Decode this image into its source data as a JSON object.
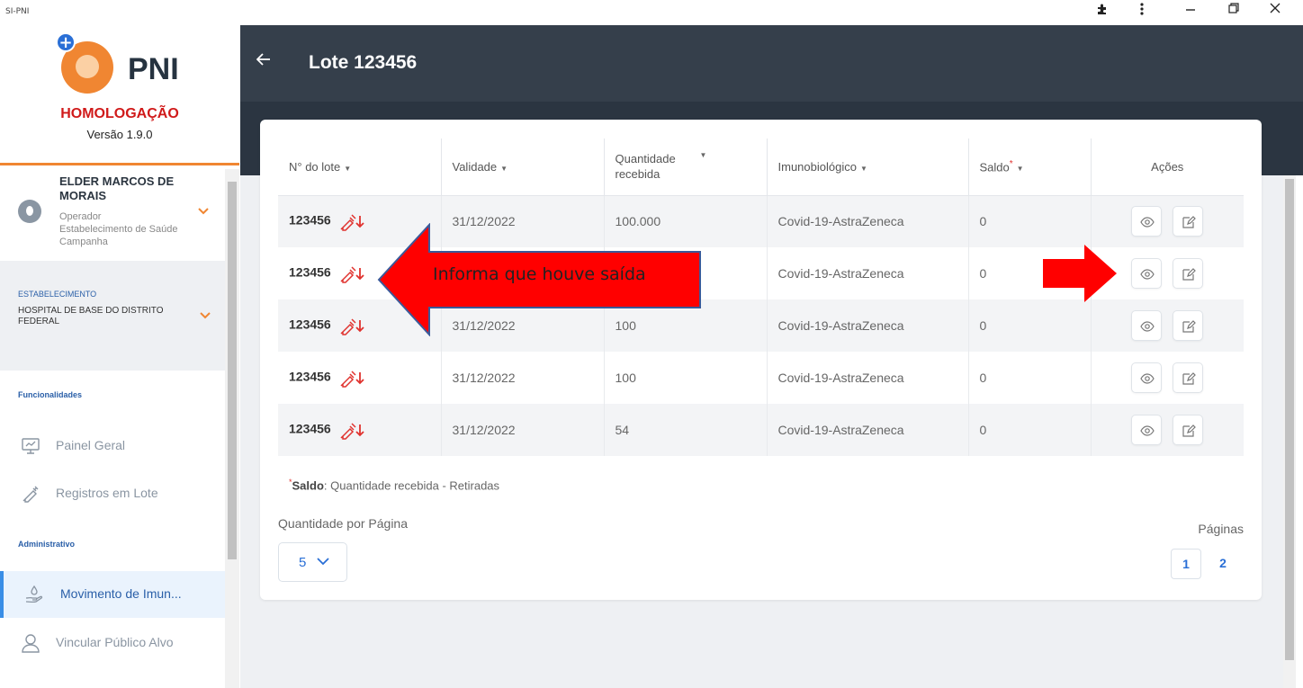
{
  "window": {
    "app_title": "SI-PNI",
    "controls": [
      "puzzle-icon",
      "menu-icon",
      "minimize-icon",
      "restore-icon",
      "close-icon"
    ]
  },
  "sidebar": {
    "logo_text": "PNI",
    "environment": "HOMOLOGAÇÃO",
    "version": "Versão 1.9.0",
    "user": {
      "name": "ELDER MARCOS DE MORAIS",
      "role": "Operador",
      "unit": "Estabelecimento de Saúde Campanha"
    },
    "establishment": {
      "title": "ESTABELECIMENTO",
      "name": "HOSPITAL DE BASE DO DISTRITO FEDERAL"
    },
    "sections": [
      {
        "label": "Funcionalidades",
        "items": [
          {
            "label": "Painel Geral",
            "icon": "monitor-icon"
          },
          {
            "label": "Registros em Lote",
            "icon": "syringe-icon"
          }
        ]
      },
      {
        "label": "Administrativo",
        "items": [
          {
            "label": "Movimento de Imun...",
            "icon": "hand-drop-icon",
            "active": true
          },
          {
            "label": "Vincular Público Alvo",
            "icon": "user-icon"
          }
        ]
      }
    ]
  },
  "header": {
    "title": "Lote 123456"
  },
  "table": {
    "columns": [
      "N° do lote",
      "Validade",
      "Quantidade recebida",
      "Imunobiológico",
      "Saldo",
      "Ações"
    ],
    "rows": [
      {
        "lote": "123456",
        "validade": "31/12/2022",
        "quantidade": "100.000",
        "imuno": "Covid-19-AstraZeneca",
        "saldo": "0"
      },
      {
        "lote": "123456",
        "validade": "",
        "quantidade": "",
        "imuno": "Covid-19-AstraZeneca",
        "saldo": "0"
      },
      {
        "lote": "123456",
        "validade": "31/12/2022",
        "quantidade": "100",
        "imuno": "Covid-19-AstraZeneca",
        "saldo": "0"
      },
      {
        "lote": "123456",
        "validade": "31/12/2022",
        "quantidade": "100",
        "imuno": "Covid-19-AstraZeneca",
        "saldo": "0"
      },
      {
        "lote": "123456",
        "validade": "31/12/2022",
        "quantidade": "54",
        "imuno": "Covid-19-AstraZeneca",
        "saldo": "0"
      }
    ]
  },
  "footnote": {
    "term": "Saldo",
    "text": ": Quantidade recebida - Retiradas"
  },
  "pagination": {
    "per_page_label": "Quantidade por Página",
    "per_page_value": "5",
    "pages_label": "Páginas",
    "pages": [
      "1",
      "2"
    ],
    "current_page": "1"
  },
  "annotation": {
    "callout_text": "Informa que houve saída",
    "color": "#ff0000"
  },
  "colors": {
    "header": "#353f4b",
    "accent_orange": "#f08632",
    "accent_blue": "#2a6fd6",
    "env_red": "#d01a1a"
  }
}
